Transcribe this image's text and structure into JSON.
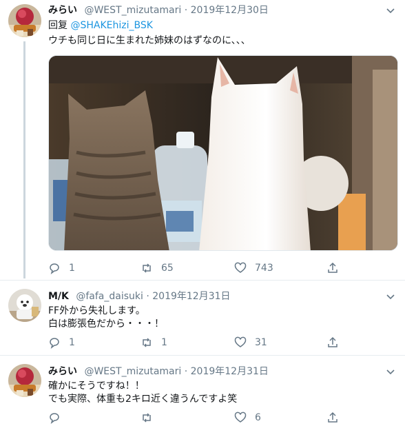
{
  "tweets": [
    {
      "name": "みらい",
      "handle": "@WEST_mizutamari",
      "dot": "·",
      "date": "2019年12月30日",
      "reply_prefix": "回复 ",
      "reply_to": "@SHAKEhizi_BSK",
      "text_lines": [
        "ウチも同じ日に生まれた姉妹のはずなのに、、、"
      ],
      "stats": {
        "replies": "1",
        "retweets": "65",
        "likes": "743"
      }
    },
    {
      "name": "M/K",
      "handle": "@fafa_daisuki",
      "dot": "·",
      "date": "2019年12月31日",
      "text_lines": [
        "FF外から失礼します。",
        "白は膨張色だから・・・！"
      ],
      "stats": {
        "replies": "1",
        "retweets": "1",
        "likes": "31"
      }
    },
    {
      "name": "みらい",
      "handle": "@WEST_mizutamari",
      "dot": "·",
      "date": "2019年12月31日",
      "text_lines": [
        "確かにそうですね！！",
        "でも実際、体重も2キロ近く違うんですよ笑"
      ],
      "stats": {
        "replies": "",
        "retweets": "",
        "likes": "6"
      }
    }
  ],
  "icons": {
    "reply": "reply-icon",
    "retweet": "retweet-icon",
    "like": "heart-icon",
    "share": "share-icon",
    "caret": "chevron-down-icon"
  },
  "colors": {
    "text": "#14171a",
    "secondary": "#657786",
    "link": "#1b95e0",
    "thread_line": "#ccd6dd",
    "separator": "#e6ecf0"
  }
}
